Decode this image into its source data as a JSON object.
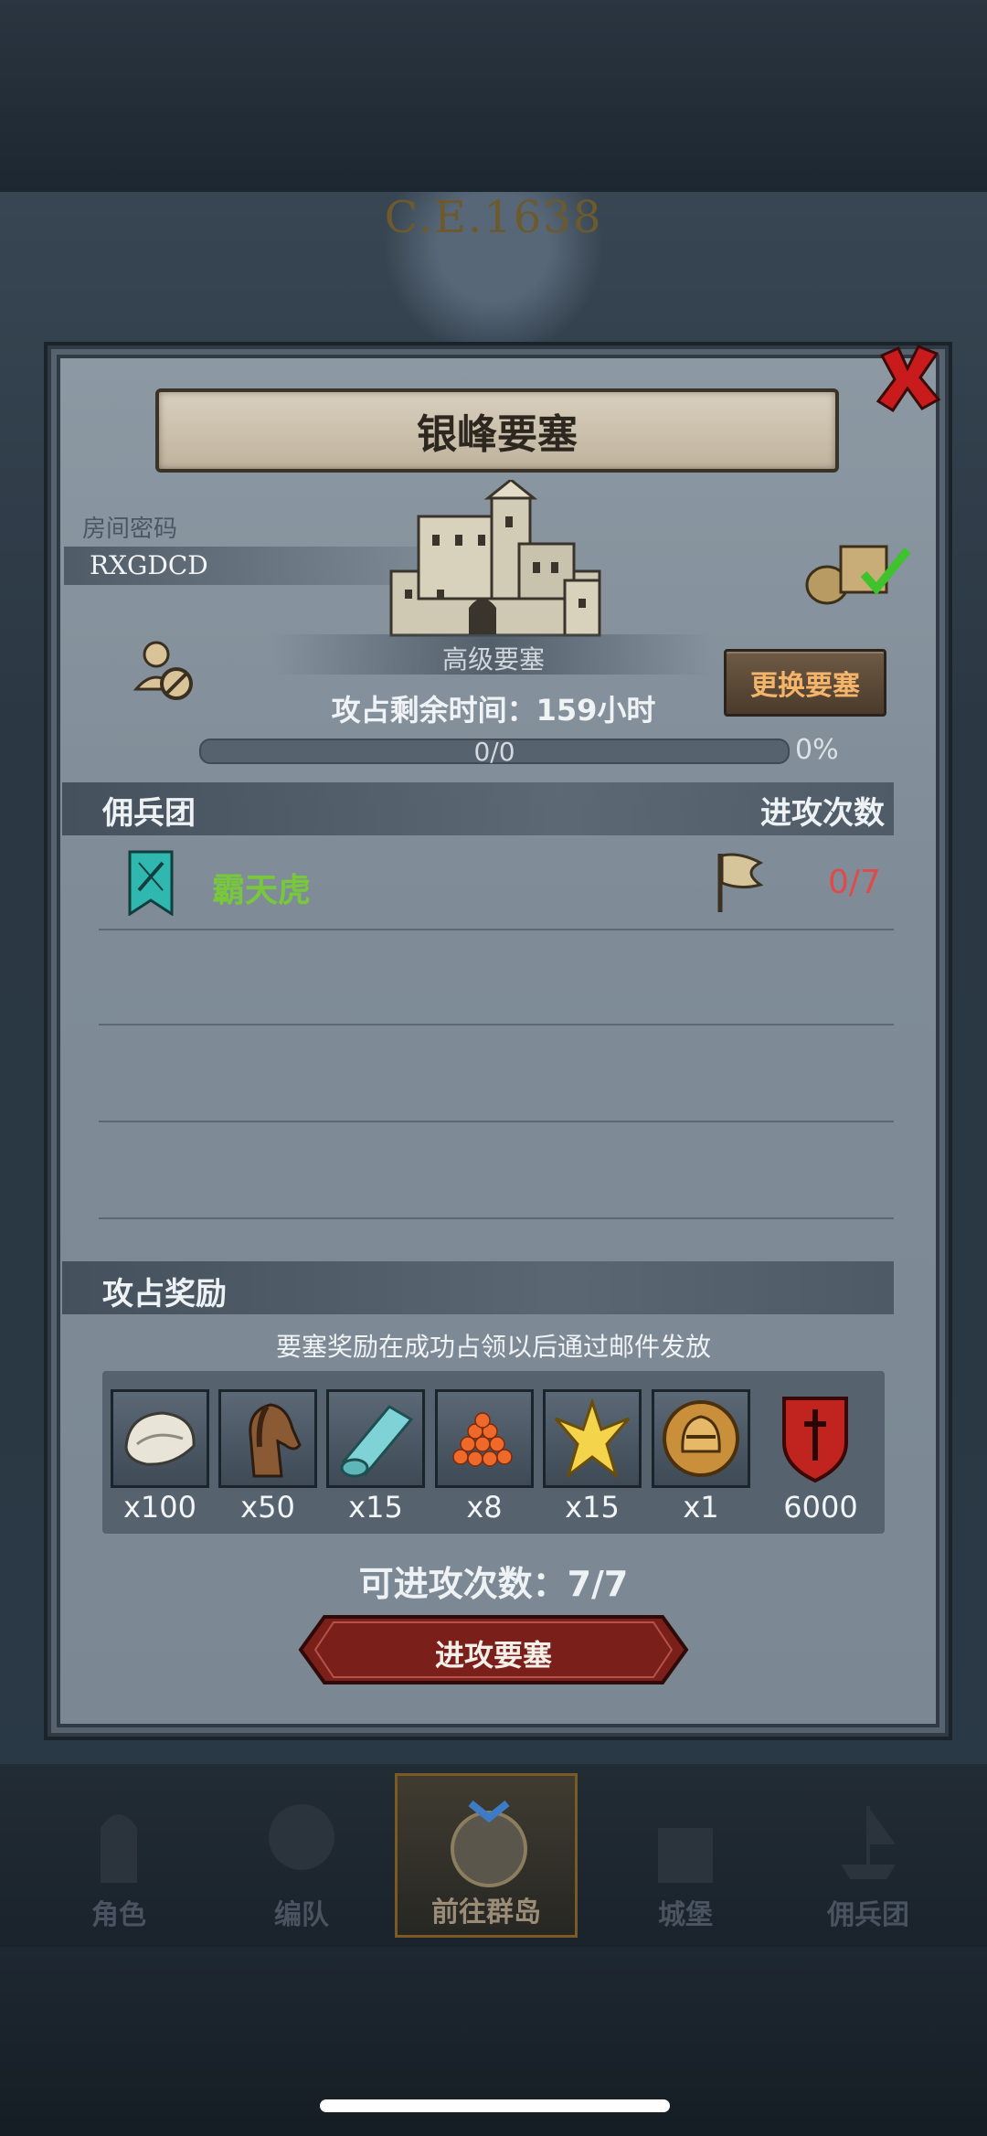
{
  "background": {
    "era_text": "C.E.1638"
  },
  "dialog": {
    "title": "银峰要塞",
    "room_label": "房间密码",
    "room_code": "RXGDCD",
    "fortress_level": "高级要塞",
    "change_button": "更换要塞",
    "time_left": "攻占剩余时间：159小时",
    "progress": {
      "text": "0/0",
      "percent_text": "0%",
      "fraction": 0
    },
    "mercenary_section": {
      "title": "佣兵团",
      "right_title": "进攻次数"
    },
    "mercenaries": [
      {
        "name": "霸天虎",
        "attacks": "0/7"
      }
    ],
    "reward_section": {
      "title": "攻占奖励",
      "note": "要塞奖励在成功占领以后通过邮件发放"
    },
    "rewards": [
      {
        "icon": "oyster-icon",
        "qty": "x100"
      },
      {
        "icon": "horse-icon",
        "qty": "x50"
      },
      {
        "icon": "cloth-roll-icon",
        "qty": "x15"
      },
      {
        "icon": "caviar-icon",
        "qty": "x8"
      },
      {
        "icon": "gold-crest-icon",
        "qty": "x15"
      },
      {
        "icon": "helmet-coin-icon",
        "qty": "x1"
      },
      {
        "icon": "red-shield-icon",
        "qty": "6000"
      }
    ],
    "attempts_text": "可进攻次数：7/7",
    "attack_button": "进攻要塞"
  },
  "nav": {
    "items": [
      {
        "label": "角色",
        "icon": "knight-icon"
      },
      {
        "label": "编队",
        "icon": "formation-icon"
      },
      {
        "label": "前往群岛",
        "icon": "island-map-icon",
        "active": true
      },
      {
        "label": "城堡",
        "icon": "castle-icon"
      },
      {
        "label": "佣兵团",
        "icon": "mercenary-ship-icon"
      }
    ]
  }
}
